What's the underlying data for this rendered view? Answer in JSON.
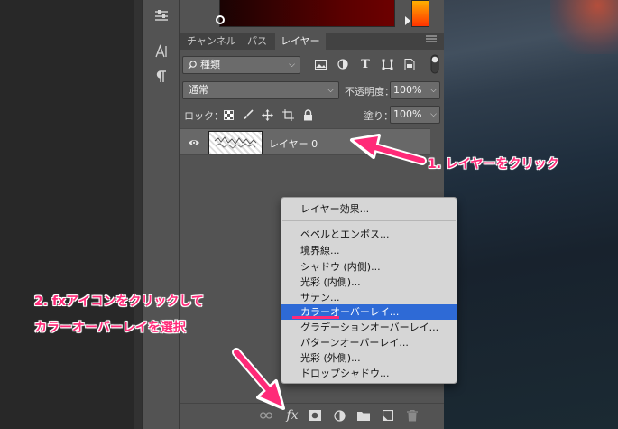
{
  "panel": {
    "tabs": [
      "チャンネル",
      "パス",
      "レイヤー"
    ],
    "active_tab": 2,
    "filter": {
      "label": "種類"
    },
    "blend_mode": "通常",
    "opacity": {
      "label": "不透明度：",
      "value": "100%"
    },
    "lock": {
      "label": "ロック："
    },
    "fill": {
      "label": "塗り：",
      "value": "100%"
    },
    "layers": [
      {
        "name": "レイヤー 0",
        "visible": true
      }
    ]
  },
  "context_menu": {
    "items": [
      "レイヤー効果...",
      "ベベルとエンボス...",
      "境界線...",
      "シャドウ (内側)...",
      "光彩 (内側)...",
      "サテン...",
      "カラーオーバーレイ...",
      "グラデーションオーバーレイ...",
      "パターンオーバーレイ...",
      "光彩 (外側)...",
      "ドロップシャドウ..."
    ],
    "highlighted_index": 6
  },
  "bottom_bar": {
    "fx_label": "fx"
  },
  "annotations": {
    "step1": "1. レイヤーをクリック",
    "step2_line1": "2. fxアイコンをクリックして",
    "step2_line2": "カラーオーバーレイを選択"
  },
  "colors": {
    "accent_annotation": "#ff2a78",
    "menu_highlight": "#2e6ad6",
    "panel_bg": "#535353"
  },
  "icons": [
    "adjust-sliders-icon",
    "character-icon",
    "paragraph-icon",
    "search-icon",
    "image-filter-icon",
    "adjustment-filter-icon",
    "type-filter-icon",
    "shape-filter-icon",
    "smart-object-filter-icon",
    "lock-pixels-icon",
    "lock-brush-icon",
    "lock-move-icon",
    "lock-artboard-icon",
    "lock-all-icon",
    "eye-icon",
    "link-icon",
    "fx-icon",
    "mask-icon",
    "adjustment-layer-icon",
    "folder-icon",
    "new-layer-icon",
    "trash-icon"
  ]
}
